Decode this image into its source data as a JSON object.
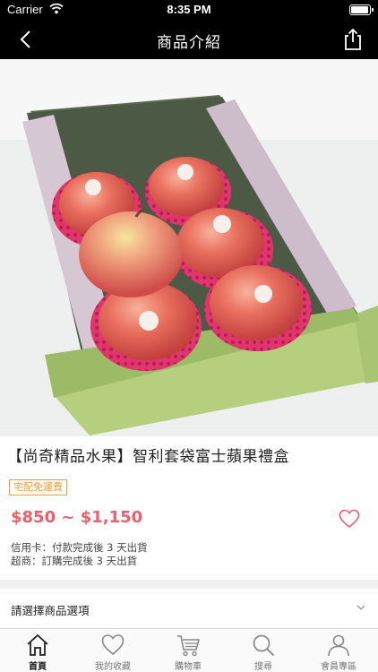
{
  "status_bar": {
    "carrier": "Carrier",
    "time": "8:35 PM"
  },
  "nav": {
    "title": "商品介紹"
  },
  "product": {
    "title": "【尚奇精品水果】智利套袋富士蘋果禮盒",
    "shipping_badge": "宅配免運費",
    "price_range": "$850 ~ $1,150",
    "shipping_notes": [
      "信用卡：付款完成後 3 天出貨",
      "超商：訂購完成後 3 天出貨"
    ]
  },
  "options": {
    "label": "請選擇商品選項"
  },
  "tabs": [
    {
      "label": "首頁",
      "icon": "home-icon",
      "active": true
    },
    {
      "label": "我的收藏",
      "icon": "heart-icon",
      "active": false
    },
    {
      "label": "購物車",
      "icon": "cart-icon",
      "active": false
    },
    {
      "label": "搜尋",
      "icon": "search-icon",
      "active": false
    },
    {
      "label": "會員專區",
      "icon": "user-icon",
      "active": false
    }
  ],
  "colors": {
    "accent_price": "#ef5c6c",
    "badge_orange": "#f29b37",
    "nav_bg": "#000000"
  }
}
